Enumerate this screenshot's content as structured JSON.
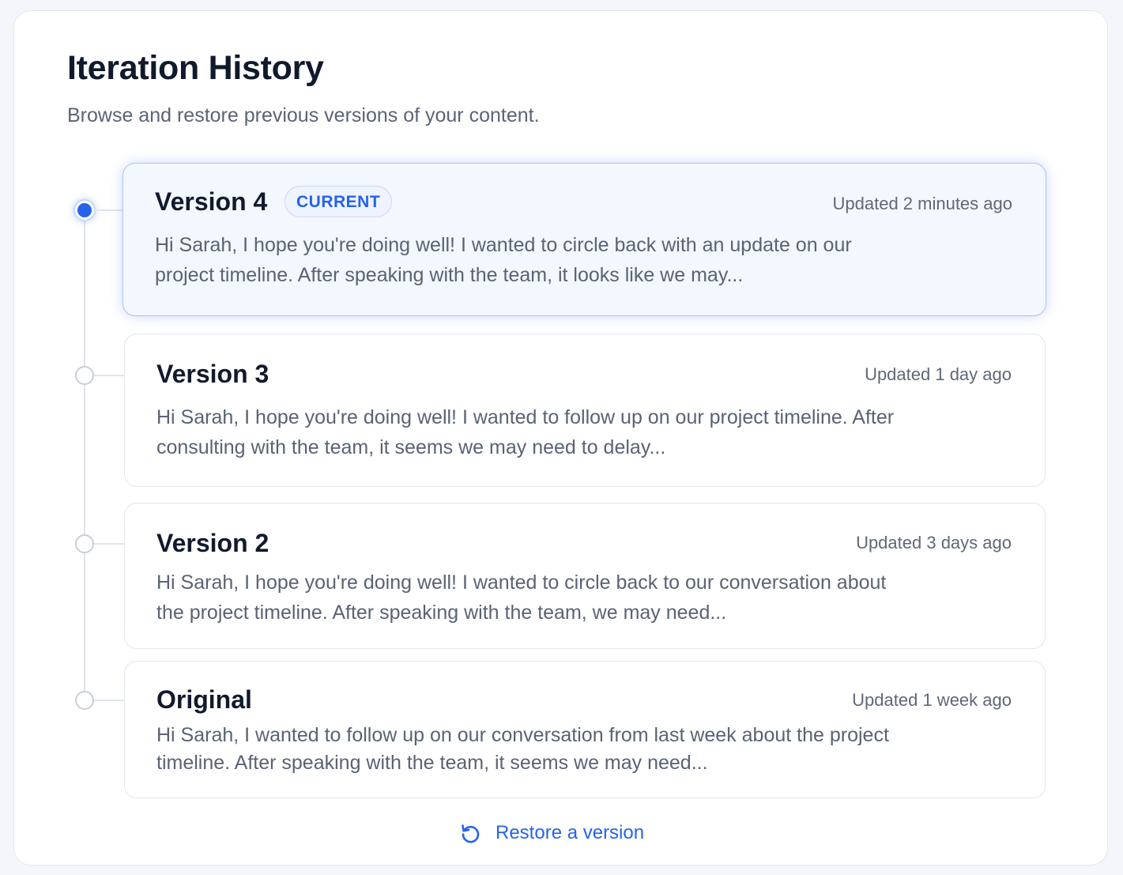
{
  "header": {
    "title": "Iteration History",
    "subtitle": "Browse and restore previous versions of your content."
  },
  "versions": [
    {
      "title": "Version 4",
      "badge": "CURRENT",
      "updated": "Updated 2 minutes ago",
      "preview": "Hi Sarah, I hope you're doing well! I wanted to circle back with an update on our project timeline. After speaking with the team, it looks like we may..."
    },
    {
      "title": "Version 3",
      "updated": "Updated 1 day ago",
      "preview": "Hi Sarah, I hope you're doing well! I wanted to follow up on our project timeline. After consulting with the team, it seems we may need to delay..."
    },
    {
      "title": "Version 2",
      "updated": "Updated 3 days ago",
      "preview": "Hi Sarah, I hope you're doing well! I wanted to circle back to our conversation about the project timeline. After speaking with the team, we may need..."
    },
    {
      "title": "Original",
      "updated": "Updated 1 week ago",
      "preview": "Hi Sarah, I wanted to follow up on our conversation from last week about the project timeline. After speaking with the team, it seems we may need..."
    }
  ],
  "footer": {
    "restore_label": "Restore a version",
    "restore_icon": "restore-icon"
  },
  "colors": {
    "accent": "#2563eb",
    "title": "#111a2c",
    "body_text": "#596374",
    "current_card_bg": "#f3f7fe",
    "current_card_border": "#a9c4f4"
  }
}
